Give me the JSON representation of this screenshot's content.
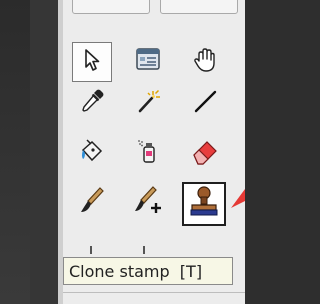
{
  "toolbox": {
    "tools": [
      {
        "name": "Pointer",
        "icon": "arrow-pointer-icon"
      },
      {
        "name": "Browse",
        "icon": "browser-window-icon"
      },
      {
        "name": "Hand",
        "icon": "hand-icon"
      },
      {
        "name": "Eyedropper",
        "icon": "eyedropper-icon"
      },
      {
        "name": "Magic wand",
        "icon": "magic-wand-icon"
      },
      {
        "name": "Line",
        "icon": "line-icon"
      },
      {
        "name": "Paint bucket",
        "icon": "paint-bucket-icon"
      },
      {
        "name": "Spray",
        "icon": "spray-can-icon"
      },
      {
        "name": "Eraser",
        "icon": "eraser-icon"
      },
      {
        "name": "Brush",
        "icon": "brush-icon"
      },
      {
        "name": "Brush plus",
        "icon": "brush-plus-icon"
      },
      {
        "name": "Clone stamp",
        "icon": "clone-stamp-icon"
      }
    ],
    "active_tool": "Clone stamp"
  },
  "tooltip": {
    "text": "Clone stamp  [T]"
  },
  "colors": {
    "panel": "#ececec",
    "dark_bg": "#2e2e2e",
    "tooltip_bg": "#f7f7e6",
    "accent_arrow": "#e53935"
  }
}
